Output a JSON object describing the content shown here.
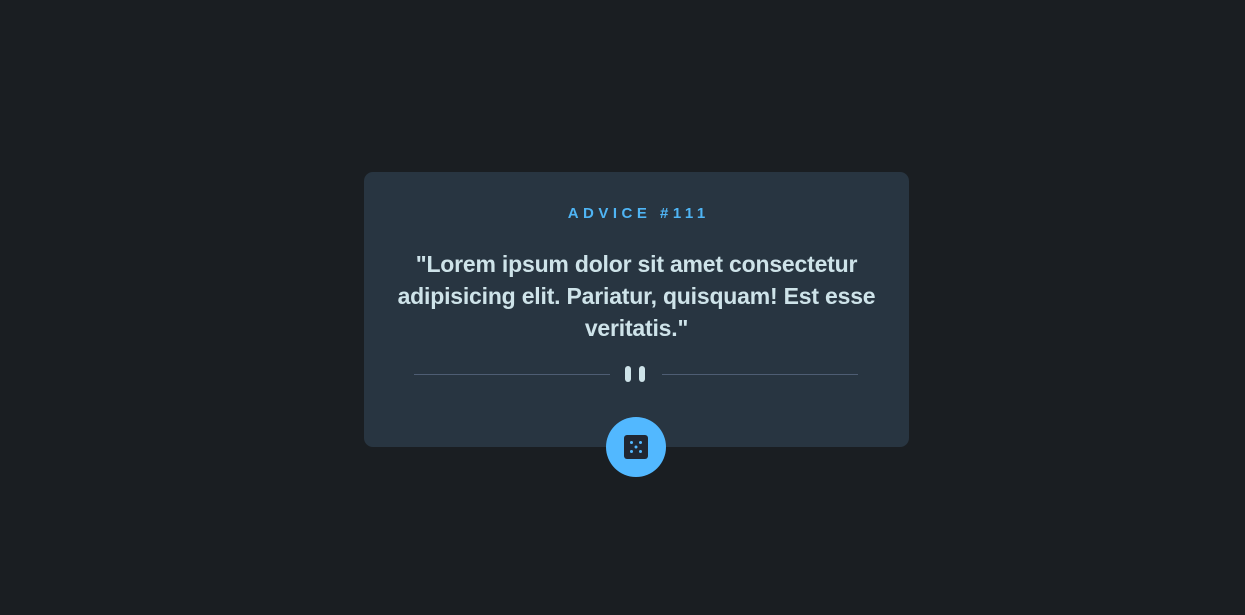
{
  "advice": {
    "label": "ADVICE #111",
    "quote": "\"Lorem ipsum dolor sit amet consectetur adipisicing elit. Pariatur, quisquam! Est esse veritatis.\""
  },
  "icons": {
    "divider": "pause-icon",
    "button": "dice-icon"
  },
  "colors": {
    "background": "#1a1e22",
    "card": "#283541",
    "accent": "#4fb5f5",
    "text": "#cee3e9",
    "button": "#52b8ff"
  }
}
